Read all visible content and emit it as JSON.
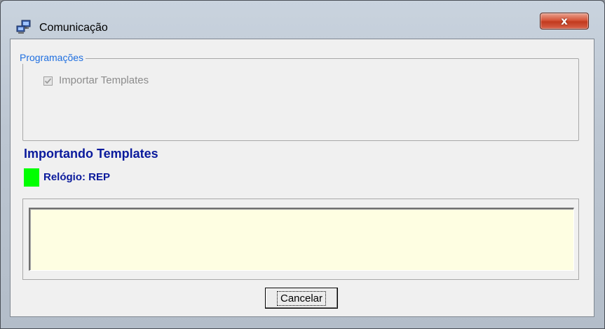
{
  "window": {
    "title": "Comunicação",
    "close_label": "x"
  },
  "group": {
    "legend": "Programações",
    "checkbox_label": "Importar Templates",
    "checkbox_checked": true,
    "checkbox_enabled": false
  },
  "status": {
    "title": "Importando Templates",
    "clock_label": "Relógio: REP",
    "indicator_color": "#00ff00"
  },
  "log": {
    "content": ""
  },
  "buttons": {
    "cancel_label": "Cancelar"
  },
  "colors": {
    "legend_text": "#1f6fe0",
    "status_text": "#0a1a9c",
    "log_background": "#fefee2",
    "close_button": "#c23a1e"
  },
  "icons": {
    "app": "network-computers-icon",
    "close": "close-icon",
    "check": "checkmark-icon"
  }
}
